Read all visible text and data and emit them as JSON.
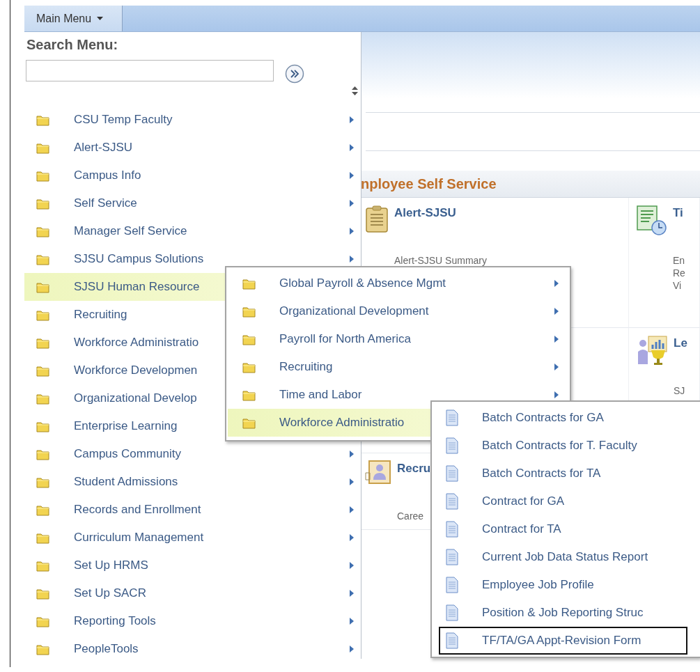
{
  "top_bar": {
    "main_menu_button": "Main Menu"
  },
  "background_page": {
    "section_title": "nployee Self Service",
    "pagelets": [
      {
        "kind": "clipboard",
        "title": "Alert-SJSU",
        "lines": [
          "Alert-SJSU Summary"
        ]
      },
      {
        "kind": "schedule",
        "title": "Ti",
        "lines": [
          "En",
          "Re",
          "Vi"
        ]
      },
      {
        "kind": "blank"
      },
      {
        "kind": "learning",
        "title": "Le",
        "lines": [
          "SJ"
        ]
      },
      {
        "kind": "recruit",
        "title": "Recru",
        "lines": [
          "Caree"
        ]
      }
    ]
  },
  "main_menu": {
    "search_label": "Search Menu:",
    "items": [
      {
        "label": "CSU Temp Faculty",
        "selected": false,
        "arrow": true
      },
      {
        "label": "Alert-SJSU",
        "selected": false,
        "arrow": true
      },
      {
        "label": "Campus Info",
        "selected": false,
        "arrow": true
      },
      {
        "label": "Self Service",
        "selected": false,
        "arrow": true
      },
      {
        "label": "Manager Self Service",
        "selected": false,
        "arrow": true
      },
      {
        "label": "SJSU Campus Solutions",
        "selected": false,
        "arrow": true
      },
      {
        "label": "SJSU Human Resource",
        "selected": true,
        "arrow": false
      },
      {
        "label": "Recruiting",
        "selected": false,
        "arrow": false
      },
      {
        "label": "Workforce Administratio",
        "selected": false,
        "arrow": false
      },
      {
        "label": "Workforce Developmen",
        "selected": false,
        "arrow": false
      },
      {
        "label": "Organizational Develop",
        "selected": false,
        "arrow": false
      },
      {
        "label": "Enterprise Learning",
        "selected": false,
        "arrow": false
      },
      {
        "label": "Campus Community",
        "selected": false,
        "arrow": true
      },
      {
        "label": "Student Admissions",
        "selected": false,
        "arrow": true
      },
      {
        "label": "Records and Enrollment",
        "selected": false,
        "arrow": true
      },
      {
        "label": "Curriculum Management",
        "selected": false,
        "arrow": true
      },
      {
        "label": "Set Up HRMS",
        "selected": false,
        "arrow": true
      },
      {
        "label": "Set Up SACR",
        "selected": false,
        "arrow": true
      },
      {
        "label": "Reporting Tools",
        "selected": false,
        "arrow": true
      },
      {
        "label": "PeopleTools",
        "selected": false,
        "arrow": true
      }
    ]
  },
  "submenu_1": {
    "items": [
      {
        "label": "Global Payroll & Absence Mgmt",
        "selected": false,
        "arrow": true
      },
      {
        "label": "Organizational Development",
        "selected": false,
        "arrow": true
      },
      {
        "label": "Payroll for North America",
        "selected": false,
        "arrow": true
      },
      {
        "label": "Recruiting",
        "selected": false,
        "arrow": true
      },
      {
        "label": "Time and Labor",
        "selected": false,
        "arrow": true
      },
      {
        "label": "Workforce Administratio",
        "selected": true,
        "arrow": false
      }
    ]
  },
  "submenu_2": {
    "items": [
      {
        "label": "Batch Contracts for GA",
        "focused": false
      },
      {
        "label": "Batch Contracts for T. Faculty",
        "focused": false
      },
      {
        "label": "Batch Contracts for TA",
        "focused": false
      },
      {
        "label": "Contract for GA",
        "focused": false
      },
      {
        "label": "Contract for TA",
        "focused": false
      },
      {
        "label": "Current Job Data Status Report",
        "focused": false
      },
      {
        "label": "Employee Job Profile",
        "focused": false
      },
      {
        "label": "Position & Job Reporting Struc",
        "focused": false
      },
      {
        "label": "TF/TA/GA Appt-Revision Form",
        "focused": true
      }
    ]
  }
}
